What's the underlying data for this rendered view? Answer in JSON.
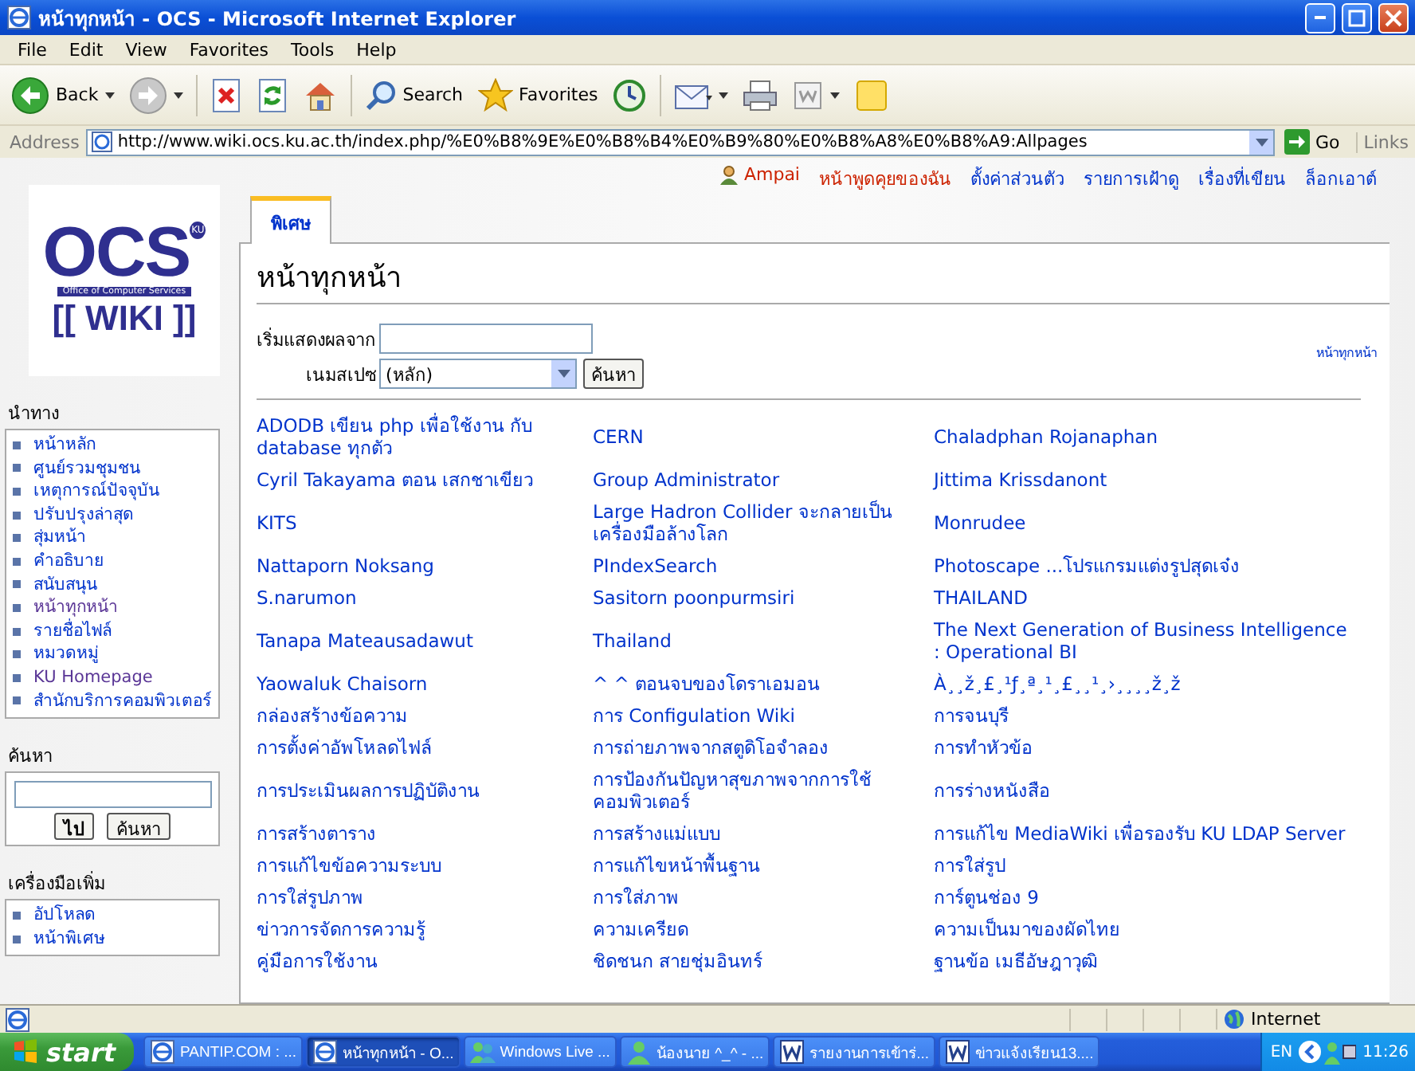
{
  "window": {
    "title": "หน้าทุกหน้า - OCS - Microsoft Internet Explorer"
  },
  "menu": [
    "File",
    "Edit",
    "View",
    "Favorites",
    "Tools",
    "Help"
  ],
  "toolbar": [
    {
      "kind": "back",
      "label": "Back"
    },
    {
      "kind": "forward"
    },
    {
      "kind": "stop"
    },
    {
      "kind": "refresh"
    },
    {
      "kind": "home"
    },
    {
      "kind": "search",
      "label": "Search"
    },
    {
      "kind": "favorites",
      "label": "Favorites"
    },
    {
      "kind": "history"
    },
    {
      "kind": "mail"
    },
    {
      "kind": "print"
    },
    {
      "kind": "edit"
    },
    {
      "kind": "note"
    }
  ],
  "address": {
    "label": "Address",
    "value": "http://www.wiki.ocs.ku.ac.th/index.php/%E0%B8%9E%E0%B8%B4%E0%B9%80%E0%B8%A8%E0%B8%A9:Allpages",
    "go": "Go",
    "links": "Links"
  },
  "personal": [
    {
      "label": "Ampai",
      "kind": "user",
      "missing": true
    },
    {
      "label": "หน้าพูดคุยของฉัน",
      "kind": "link",
      "missing": true
    },
    {
      "label": "ตั้งค่าส่วนตัว",
      "kind": "link",
      "missing": false
    },
    {
      "label": "รายการเฝ้าดู",
      "kind": "link",
      "missing": false
    },
    {
      "label": "เรื่องที่เขียน",
      "kind": "link",
      "missing": false
    },
    {
      "label": "ล็อกเอาต์",
      "kind": "link",
      "missing": false
    }
  ],
  "logo": {
    "name": "OCS",
    "badge": "KU",
    "subtitle": "Office of Computer Services",
    "wiki": "[[ WIKI ]]"
  },
  "navigation": {
    "title": "นำทาง",
    "items": [
      {
        "label": "หน้าหลัก",
        "visited": false
      },
      {
        "label": "ศูนย์รวมชุมชน",
        "visited": false
      },
      {
        "label": "เหตุการณ์ปัจจุบัน",
        "visited": false
      },
      {
        "label": "ปรับปรุงล่าสุด",
        "visited": false
      },
      {
        "label": "สุ่มหน้า",
        "visited": false
      },
      {
        "label": "คำอธิบาย",
        "visited": false
      },
      {
        "label": "สนับสนุน",
        "visited": false
      },
      {
        "label": "หน้าทุกหน้า",
        "visited": true
      },
      {
        "label": "รายชื่อไฟล์",
        "visited": false
      },
      {
        "label": "หมวดหมู่",
        "visited": false
      },
      {
        "label": "KU Homepage",
        "visited": true
      },
      {
        "label": "สำนักบริการคอมพิวเตอร์",
        "visited": false
      }
    ]
  },
  "search": {
    "title": "ค้นหา",
    "go": "ไป",
    "submit": "ค้นหา"
  },
  "toolbox": {
    "title": "เครื่องมือเพิ่ม",
    "items": [
      {
        "label": "อัปโหลด",
        "visited": false
      },
      {
        "label": "หน้าพิเศษ",
        "visited": false
      }
    ]
  },
  "content": {
    "tab": {
      "label": "พิเศษ",
      "selected": true
    },
    "heading": "หน้าทุกหน้า",
    "from_label": "เริ่มแสดงผลจาก",
    "namespace_label": "เนมสเปซ",
    "namespace_value": "(หลัก)",
    "submit": "ค้นหา",
    "side_link": "หน้าทุกหน้า",
    "rows": [
      [
        "ADODB เขียน php เพื่อใช้งาน กับ database ทุกตัว",
        "CERN",
        "Chaladphan Rojanaphan"
      ],
      [
        "Cyril Takayama ตอน เสกชาเขียว",
        "Group Administrator",
        "Jittima Krissdanont"
      ],
      [
        "KITS",
        "Large Hadron Collider จะกลายเป็นเครื่องมือล้างโลก",
        "Monrudee"
      ],
      [
        "Nattaporn Noksang",
        "PIndexSearch",
        "Photoscape ...โปรแกรมแต่งรูปสุดเจ๋ง"
      ],
      [
        "S.narumon",
        "Sasitorn poonpurmsiri",
        "THAILAND"
      ],
      [
        "Tanapa Mateausadawut",
        "Thailand",
        "The Next Generation of Business Intelligence : Operational BI"
      ],
      [
        "Yaowaluk Chaisorn",
        "^ ^ ตอนจบของโดราเอมอน",
        "À¸¸ž¸£¸¹ƒ¸ª¸¹¸£¸¸¹¸›¸¸¸¸ž¸ž"
      ],
      [
        "กล่องสร้างข้อความ",
        "การ Configulation Wiki",
        "การจนบุรี"
      ],
      [
        "การตั้งค่าอัพโหลดไฟล์",
        "การถ่ายภาพจากสตูดิโอจำลอง",
        "การทำหัวข้อ"
      ],
      [
        "การประเมินผลการปฏิบัติงาน",
        "การป้องกันปัญหาสุขภาพจากการใช้คอมพิวเตอร์",
        "การร่างหนังสือ"
      ],
      [
        "การสร้างตาราง",
        "การสร้างแม่แบบ",
        "การแก้ไข MediaWiki เพื่อรองรับ KU LDAP Server"
      ],
      [
        "การแก้ไขข้อความระบบ",
        "การแก้ไขหน้าพื้นฐาน",
        "การใส่รูป"
      ],
      [
        "การใส่รูปภาพ",
        "การใส่ภาพ",
        "การ์ตูนช่อง 9"
      ],
      [
        "ข่าวการจัดการความรู้",
        "ความเครียด",
        "ความเป็นมาของผัดไทย"
      ],
      [
        "คู่มือการใช้งาน",
        "ชิดชนก สายชุ่มอินทร์",
        "ฐานข้อ เมธีอัษฎาวุฒิ"
      ]
    ]
  },
  "status": {
    "zone": "Internet"
  },
  "taskbar": {
    "start": "start",
    "items": [
      {
        "label": "PANTIP.COM : ...",
        "kind": "ie",
        "selected": false
      },
      {
        "label": "หน้าทุกหน้า - O...",
        "kind": "ie",
        "selected": true
      },
      {
        "label": "Windows Live ...",
        "kind": "messenger",
        "selected": false
      },
      {
        "label": "น้องนาย ^_^ - ...",
        "kind": "chat",
        "selected": false
      },
      {
        "label": "รายงานการเข้าร่...",
        "kind": "word",
        "selected": false
      },
      {
        "label": "ข่าวแจ้งเรียน13....",
        "kind": "word",
        "selected": false
      }
    ],
    "language": "EN",
    "clock": "11:26"
  }
}
